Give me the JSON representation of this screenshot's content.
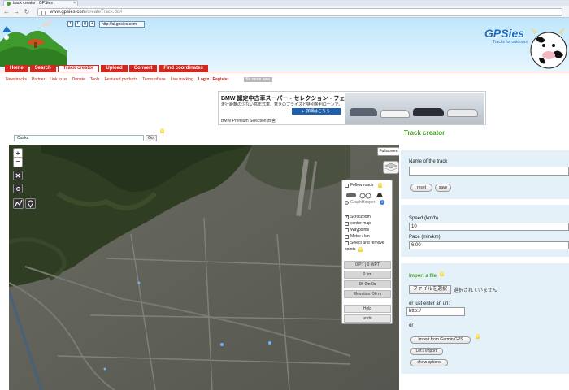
{
  "browser": {
    "tab_title": "track creator | GPSies",
    "back_glyph": "←",
    "forward_glyph": "→",
    "reload_glyph": "↻",
    "close_glyph": "×",
    "url_domain": "www.gpsies.com",
    "url_path": "/createTrack.do#"
  },
  "header": {
    "social": [
      "t",
      "f",
      "g",
      "+"
    ],
    "ad_url": "http://ai.gpsies.com",
    "logo": "GPSies",
    "tagline": "Tracks for outdoors"
  },
  "nav": {
    "items": [
      "Home",
      "Search",
      "Track creator",
      "Upload",
      "Convert",
      "Find coordinates"
    ],
    "active_index": 2
  },
  "sublinks": {
    "items": [
      "Newstracks",
      "Partner",
      "Link to us",
      "Donate",
      "Tools",
      "Featured products",
      "Terms of use",
      "Live tracking"
    ],
    "login": "Login / Register",
    "grey_button": "Be more awe"
  },
  "ad": {
    "headline": "BMW 認定中古車スーパー・セレクション・フェア。",
    "body": "走行距離の少ない高年式車、驚きのプライスと特別金利ローンで。",
    "button": "▸ 詳細はこちら",
    "footer": "BMW Premium Selection 西宮"
  },
  "search": {
    "value": "Osaka",
    "go_label": "Go!"
  },
  "map_controls": {
    "zoom_in": "+",
    "zoom_out": "−",
    "fullscreen": "Fullscreen"
  },
  "map_panel": {
    "follow_roads": "Follow roads",
    "graphhopper": "GraphHopper",
    "scrollzoom": "Scrollzoom",
    "center_map": "center map",
    "waypoints": "Waypoints",
    "metre_km": "Metre / km",
    "select_remove": "Select and remove",
    "points": "points",
    "stats": [
      "0 PT | 0 WPT",
      "0 km",
      "0h 0m 0s",
      "Elevation: 56 m"
    ],
    "help": "Help",
    "undo": "undo"
  },
  "right": {
    "title": "Track creator",
    "name_label": "Name of the track",
    "name_value": "",
    "reset": "reset",
    "save": "save",
    "speed_label": "Speed (km/h)",
    "speed_value": "10",
    "pace_label": "Pace (min/km)",
    "pace_value": "6:00",
    "import_title": "Import a file",
    "file_button": "ファイルを選択",
    "file_status": "選択されていません",
    "url_label": "or just enter an url:",
    "url_value": "http://",
    "or": "or",
    "garmin_btn": "Import from Garmin GPS",
    "lets_import": "Let's import!",
    "show_options": "show options"
  },
  "colors": {
    "nav_red": "#d4271d",
    "brand_green": "#4a9d2a",
    "brand_blue": "#1d6fc1",
    "panel_bg": "#e4f1f8"
  }
}
